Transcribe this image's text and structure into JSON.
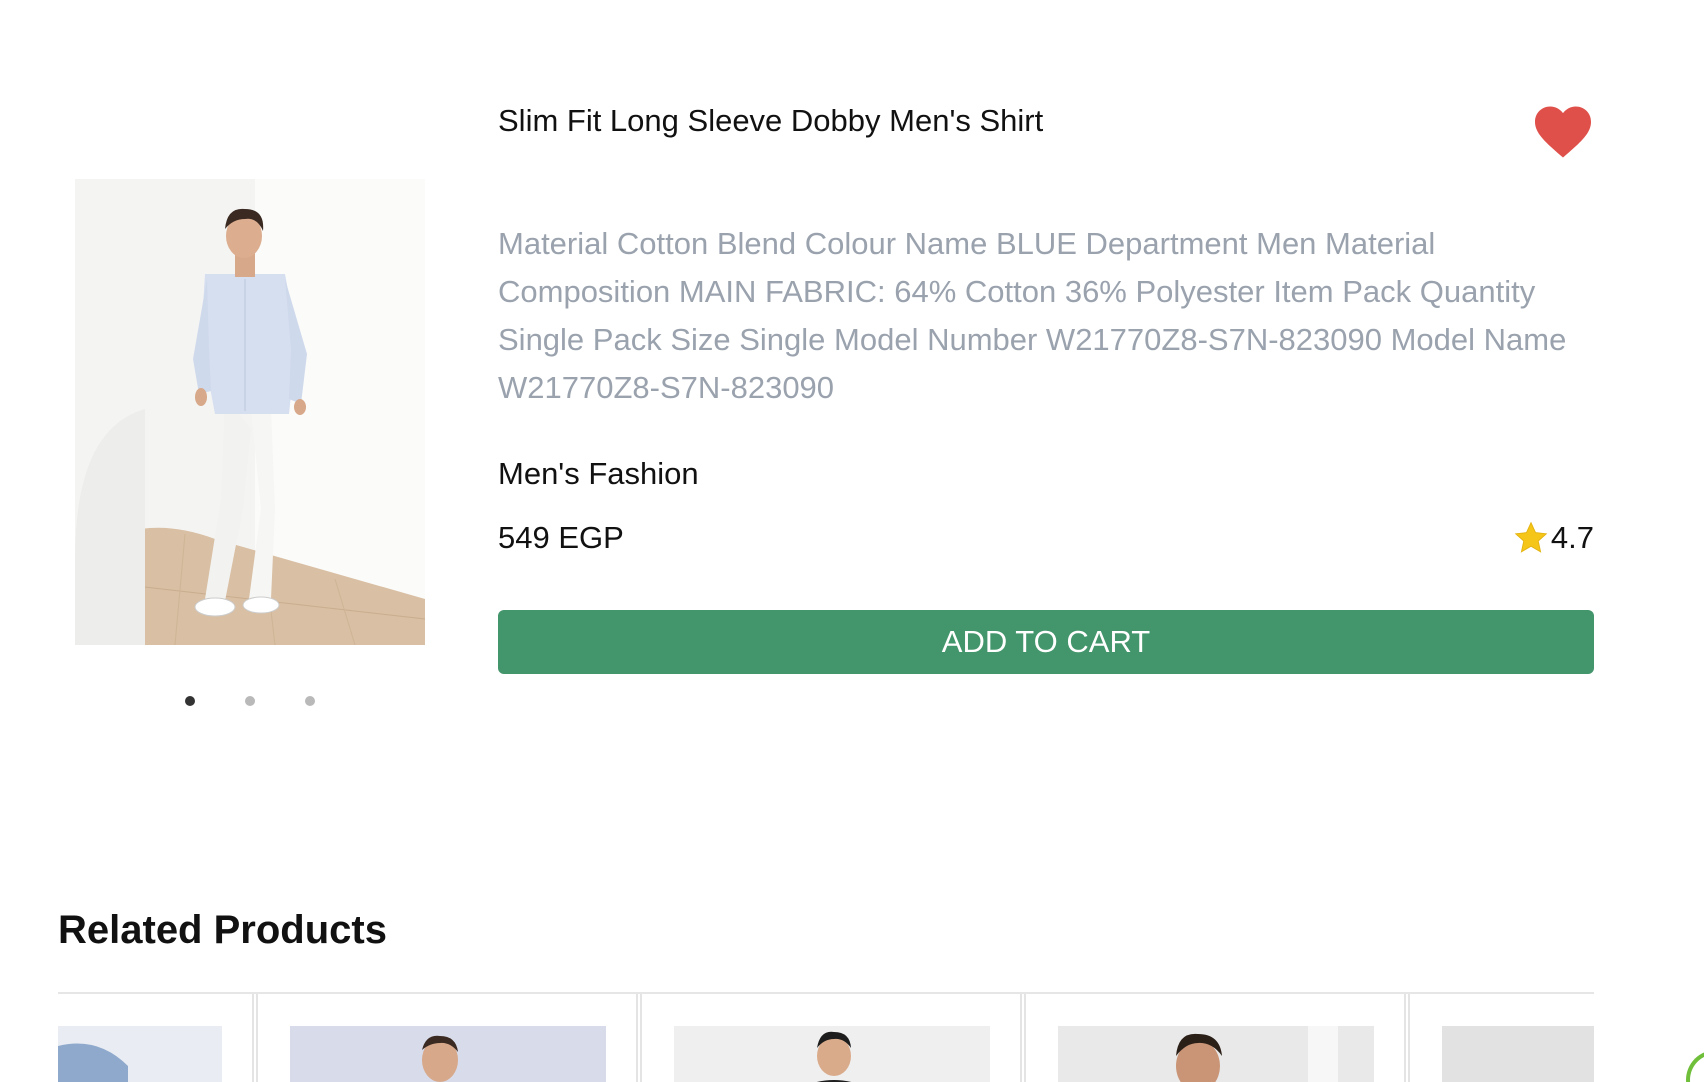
{
  "product": {
    "title": "Slim Fit Long Sleeve Dobby Men's Shirt",
    "description": "Material Cotton Blend Colour Name BLUE Department Men Material Composition MAIN FABRIC: 64% Cotton 36% Polyester Item Pack Quantity Single Pack Size Single Model Number W21770Z8-S7N-823090 Model Name W21770Z8-S7N-823090",
    "category": "Men's Fashion",
    "price": "549 EGP",
    "rating": "4.7",
    "add_to_cart_label": "ADD TO CART",
    "favorite_color": "#e0504a",
    "button_color": "#43956b",
    "rating_star_color": "#f5c518",
    "carousel": {
      "slide_count": 3,
      "active_index": 0
    }
  },
  "related": {
    "heading": "Related Products",
    "cards": [
      {
        "name": "related-card-1"
      },
      {
        "name": "related-card-2"
      },
      {
        "name": "related-card-3"
      },
      {
        "name": "related-card-4"
      },
      {
        "name": "related-card-5"
      }
    ]
  },
  "icons": {
    "favorite": "heart-icon",
    "rating": "star-icon",
    "loading": "spinner-icon"
  }
}
